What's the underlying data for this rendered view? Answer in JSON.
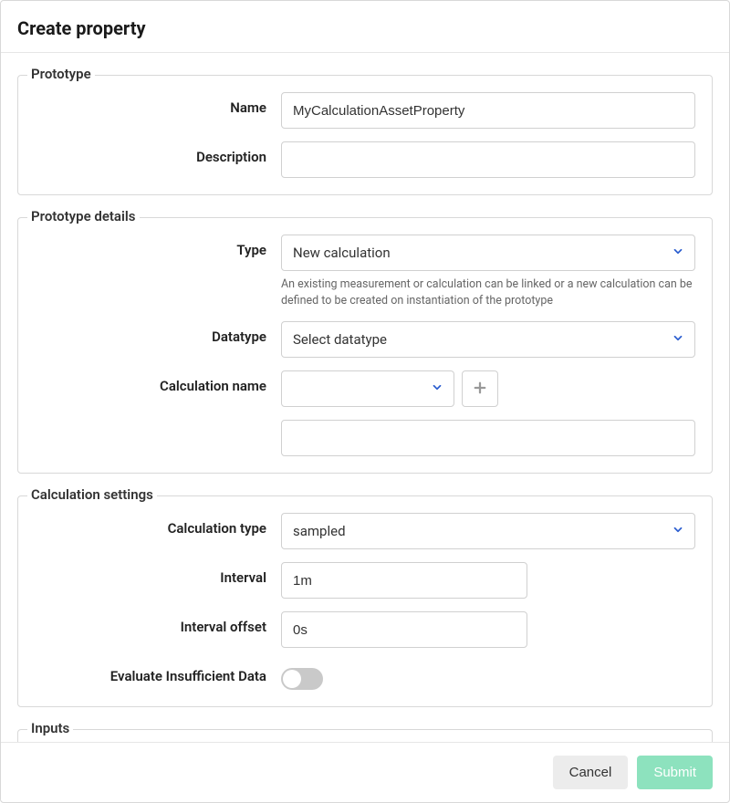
{
  "header": {
    "title": "Create property"
  },
  "prototype": {
    "legend": "Prototype",
    "name_label": "Name",
    "name_value": "MyCalculationAssetProperty",
    "description_label": "Description",
    "description_value": ""
  },
  "details": {
    "legend": "Prototype details",
    "type_label": "Type",
    "type_value": "New calculation",
    "type_help": "An existing measurement or calculation can be linked or a new calculation can be defined to be created on instantiation of the prototype",
    "datatype_label": "Datatype",
    "datatype_value": "Select datatype",
    "calcname_label": "Calculation name",
    "calcname_value": "",
    "calcname_extra_value": ""
  },
  "settings": {
    "legend": "Calculation settings",
    "calc_type_label": "Calculation type",
    "calc_type_value": "sampled",
    "interval_label": "Interval",
    "interval_value": "1m",
    "offset_label": "Interval offset",
    "offset_value": "0s",
    "eval_label": "Evaluate Insufficient Data",
    "eval_value": false
  },
  "inputs": {
    "legend": "Inputs"
  },
  "footer": {
    "cancel": "Cancel",
    "submit": "Submit"
  }
}
